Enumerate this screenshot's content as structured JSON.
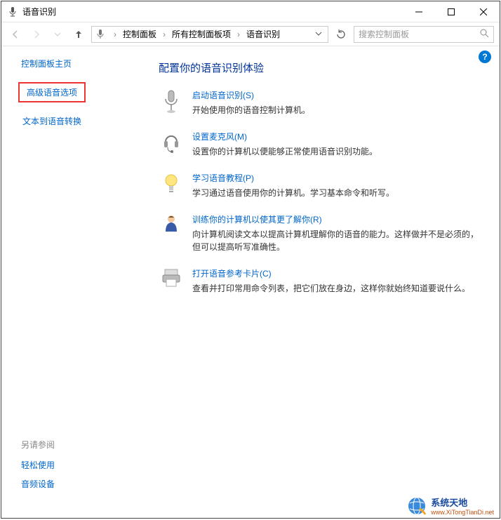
{
  "window": {
    "title": "语音识别"
  },
  "nav": {
    "breadcrumb": [
      "控制面板",
      "所有控制面板项",
      "语音识别"
    ],
    "search_placeholder": "搜索控制面板"
  },
  "sidebar": {
    "home": "控制面板主页",
    "items": [
      {
        "label": "高级语音选项",
        "highlighted": true
      },
      {
        "label": "文本到语音转换",
        "highlighted": false
      }
    ],
    "see_also_title": "另请参阅",
    "see_also": [
      "轻松使用",
      "音频设备"
    ]
  },
  "main": {
    "heading": "配置你的语音识别体验",
    "options": [
      {
        "icon": "microphone-icon",
        "link": "启动语音识别(S)",
        "desc": "开始使用你的语音控制计算机。"
      },
      {
        "icon": "headset-icon",
        "link": "设置麦克风(M)",
        "desc": "设置你的计算机以便能够正常使用语音识别功能。"
      },
      {
        "icon": "lightbulb-icon",
        "link": "学习语音教程(P)",
        "desc": "学习通过语音使用你的计算机。学习基本命令和听写。"
      },
      {
        "icon": "person-icon",
        "link": "训练你的计算机以使其更了解你(R)",
        "desc": "向计算机阅读文本以提高计算机理解你的语音的能力。这样做并不是必须的，但可以提高听写准确性。"
      },
      {
        "icon": "printer-icon",
        "link": "打开语音参考卡片(C)",
        "desc": "查看并打印常用命令列表，把它们放在身边，这样你就始终知道要说什么。"
      }
    ]
  },
  "watermark": {
    "big": "系统天地",
    "small": "www.XiTongTianDi.net"
  }
}
